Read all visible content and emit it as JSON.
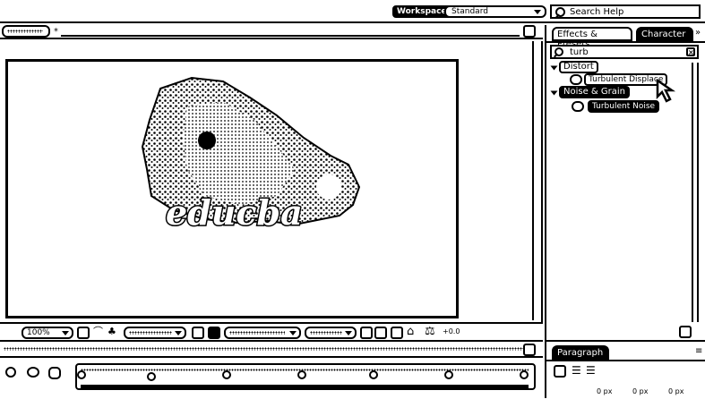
{
  "topbar": {
    "workspace_label": "Workspace:",
    "workspace_value": "Standard",
    "search_placeholder": "Search Help"
  },
  "composition": {
    "logo_text": "educba"
  },
  "effects_panel": {
    "tab_label": "Effects & Presets",
    "tab2_label": "Character",
    "search_value": "turb",
    "categories": [
      {
        "name": "Distort",
        "items": [
          "Turbulent Displace"
        ]
      },
      {
        "name": "Noise & Grain",
        "items": [
          "Turbulent Noise"
        ]
      }
    ]
  },
  "viewer_toolbar": {
    "zoom": "100%",
    "offset": "+0.0"
  },
  "paragraph_panel": {
    "tab_label": "Paragraph",
    "px_values": [
      "0 px",
      "0 px",
      "0 px"
    ]
  },
  "timeline": {
    "markers": 7
  },
  "colors": {
    "ink": "#000000",
    "paper": "#ffffff"
  }
}
